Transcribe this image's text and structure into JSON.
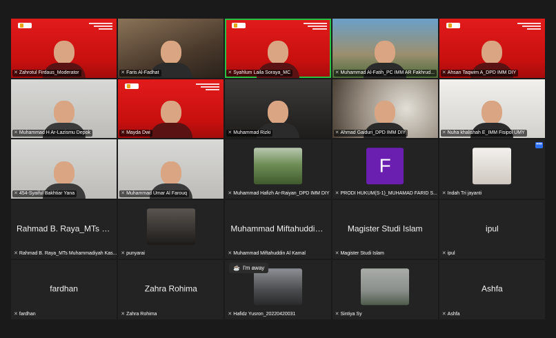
{
  "participants": [
    {
      "name": "Zahrotul Firdaus_Moderator",
      "type": "video",
      "bg": "red",
      "active": false
    },
    {
      "name": "Faris Al-Fadhat",
      "type": "video",
      "bg": "room",
      "active": false
    },
    {
      "name": "Syahlum Laila Soraya_MC",
      "type": "video",
      "bg": "red",
      "active": true
    },
    {
      "name": "Muhammad Al-Fatih_PC IMM AR Fakhrud...",
      "type": "video",
      "bg": "sky",
      "active": false
    },
    {
      "name": "Ahsan Taqwim A_DPD IMM DIY",
      "type": "video",
      "bg": "red",
      "active": false
    },
    {
      "name": "Muhammad H Ar-Lazismu Depok",
      "type": "video",
      "bg": "white",
      "active": false
    },
    {
      "name": "Mayda Dwi",
      "type": "video",
      "bg": "red",
      "active": false
    },
    {
      "name": "Muhammad Rizki",
      "type": "video",
      "bg": "dark",
      "active": false
    },
    {
      "name": "Ahmad Gaiduri_DPD IMM DIY",
      "type": "video",
      "bg": "blur",
      "active": false
    },
    {
      "name": "Nuha khalishah E_IMM Fisipol UMY",
      "type": "video",
      "bg": "light",
      "active": false
    },
    {
      "name": "454-Syaiful Bakhtiar Yana",
      "type": "video",
      "bg": "white",
      "active": false
    },
    {
      "name": "Muhammad Umar Al Farouq",
      "type": "video",
      "bg": "white",
      "active": false
    },
    {
      "name": "Muhammad Hafizh Ar-Raiyan_DPD IMM DIY",
      "type": "box",
      "box": "hills"
    },
    {
      "name": "PRODI HUKUM(S-1)_MUHAMAD FARID S...",
      "type": "box",
      "box": "purple",
      "initial": "F"
    },
    {
      "name": "Indah Tri jayanti",
      "type": "box",
      "box": "portrait"
    },
    {
      "name": "Rahmad B. Raya_MTs Muhammadiyah Kas...",
      "type": "name",
      "display": "Rahmad B. Raya_MTs Mu..."
    },
    {
      "name": "punyarai",
      "type": "box",
      "box": "dark"
    },
    {
      "name": "Muhammad Miftahuddin Al Kamal",
      "type": "name",
      "display": "Muhammad Miftahuddin..."
    },
    {
      "name": "Magister Studi Islam",
      "type": "name",
      "display": "Magister Studi Islam"
    },
    {
      "name": "ipul",
      "type": "name",
      "display": "ipul"
    },
    {
      "name": "fardhan",
      "type": "name",
      "display": "fardhan"
    },
    {
      "name": "Zahra Rohima",
      "type": "name",
      "display": "Zahra Rohima"
    },
    {
      "name": "Hafidz Yusron_20220420031",
      "type": "box",
      "box": "street"
    },
    {
      "name": "Sintiya Sy",
      "type": "box",
      "box": "sky2"
    },
    {
      "name": "Ashfa",
      "type": "name",
      "display": "Ashfa"
    }
  ],
  "status": {
    "away_label": "I'm away",
    "away_icon": "coffee-cup-icon"
  },
  "controls": {
    "more_icon": "more-options-icon",
    "more_label": "•••"
  },
  "colors": {
    "muted": "#ff3b30",
    "active_speaker": "#29c244",
    "banner_red": "#e21b1b",
    "more_button": "#2f6ff2"
  }
}
